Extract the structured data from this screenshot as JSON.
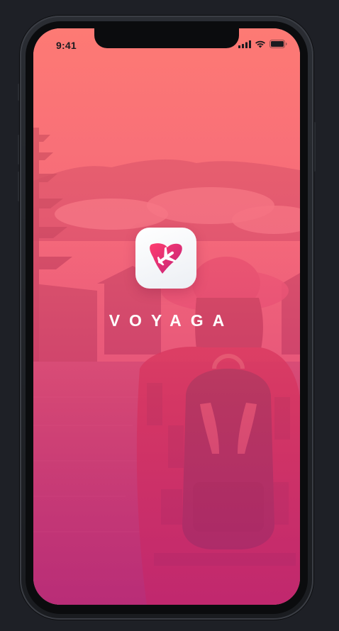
{
  "status_bar": {
    "time": "9:41",
    "signal_icon": "cellular-signal-icon",
    "wifi_icon": "wifi-icon",
    "battery_icon": "battery-icon"
  },
  "splash": {
    "app_name": "VOYAGA",
    "logo_icon": "airplane-heart-logo-icon"
  },
  "colors": {
    "overlay_top": "#ff6e69",
    "overlay_bottom": "#c42878",
    "logo_gradient_start": "#ff3d6e",
    "logo_gradient_end": "#c4237a",
    "frame_background": "#1e2026"
  }
}
